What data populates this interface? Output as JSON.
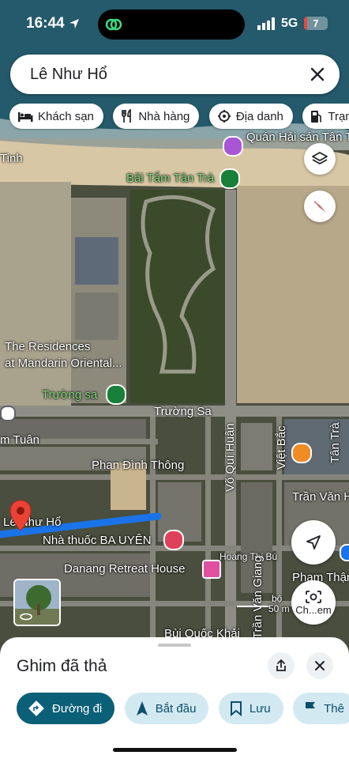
{
  "status": {
    "time": "16:44",
    "network": "5G",
    "battery": "7",
    "battery_level": 0.07
  },
  "search": {
    "query": "Lê Như Hổ"
  },
  "chips": [
    {
      "label": "Khách sạn",
      "icon": "bed-icon"
    },
    {
      "label": "Nhà hàng",
      "icon": "restaurant-icon"
    },
    {
      "label": "Địa danh",
      "icon": "landmark-icon"
    },
    {
      "label": "Trạm x",
      "icon": "gas-station-icon"
    }
  ],
  "map_labels": {
    "restaurant": "Quán Hải sản Tân Trà Be",
    "beach": "Bãi Tắm Tân Trà",
    "beach_left": "Tinh",
    "residences_1": "The Residences",
    "residences_2": "at Mandarin Oriental...",
    "truong_sa_park": "Trường sa",
    "truong_sa_road": "Trường Sa",
    "m_tuan": "m Tuân",
    "phan_dinh_thong": "Phan Đình Thông",
    "vo_qui_huan": "Võ Quí Huân",
    "viet_bac": "Việt Bắc",
    "tan_tra": "Tân Trà",
    "tran_van_h": "Trần Văn H",
    "le_nhu_ho": "Lê Như Hổ",
    "pharmacy": "Nhà thuốc BA UYÊN",
    "retreat": "Danang Retreat House",
    "hoang_thi": "Hoàng Thị Bú",
    "tran_van_giang": "Trần Văn Giang",
    "phan_thi": "Phạm Thận",
    "bui_quoc_khai": "Bùi Quốc Khải",
    "scale": "50 m",
    "scale_alt": "bộ",
    "lens_label": "Ch...em"
  },
  "sheet": {
    "title": "Ghim đã thả",
    "actions": [
      {
        "label": "Đường đi",
        "icon": "directions-icon"
      },
      {
        "label": "Bắt đầu",
        "icon": "navigation-arrow-icon"
      },
      {
        "label": "Lưu",
        "icon": "bookmark-icon"
      },
      {
        "label": "Thê",
        "icon": "flag-icon"
      }
    ]
  },
  "colors": {
    "accent": "#0b5f77",
    "route": "#1a73e8",
    "pin": "#ea4335",
    "label_green": "#7dd87a"
  }
}
